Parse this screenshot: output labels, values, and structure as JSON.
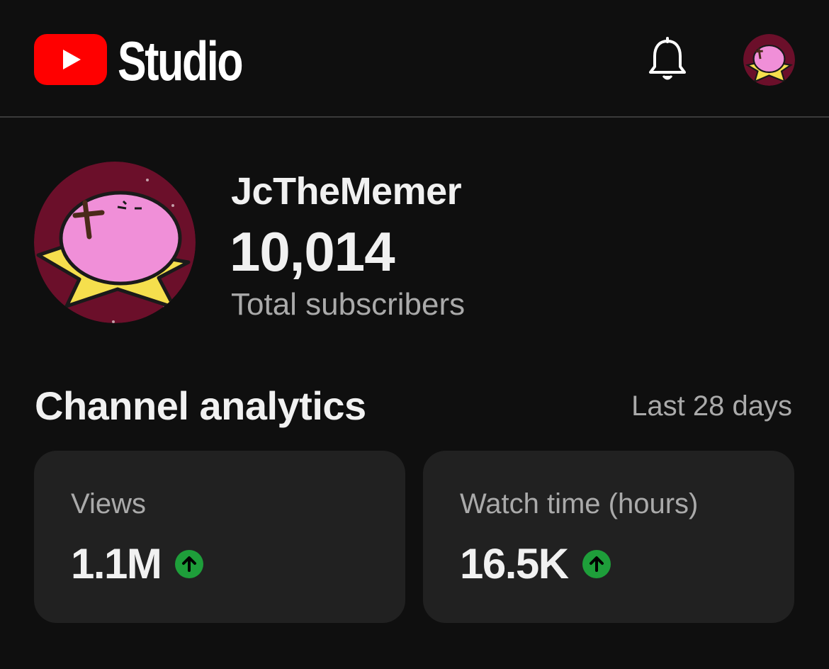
{
  "header": {
    "brand_label": "Studio",
    "brand_color": "#ff0000",
    "icons": [
      "youtube-play-icon",
      "bell-icon",
      "avatar"
    ]
  },
  "channel": {
    "name": "JcTheMemer",
    "subscriber_count": "10,014",
    "subscriber_label": "Total subscribers"
  },
  "analytics": {
    "title": "Channel analytics",
    "period": "Last 28 days",
    "cards": [
      {
        "label": "Views",
        "value": "1.1M",
        "trend": "up",
        "trend_color": "#1e9e3a"
      },
      {
        "label": "Watch time (hours)",
        "value": "16.5K",
        "trend": "up",
        "trend_color": "#1e9e3a"
      }
    ]
  }
}
